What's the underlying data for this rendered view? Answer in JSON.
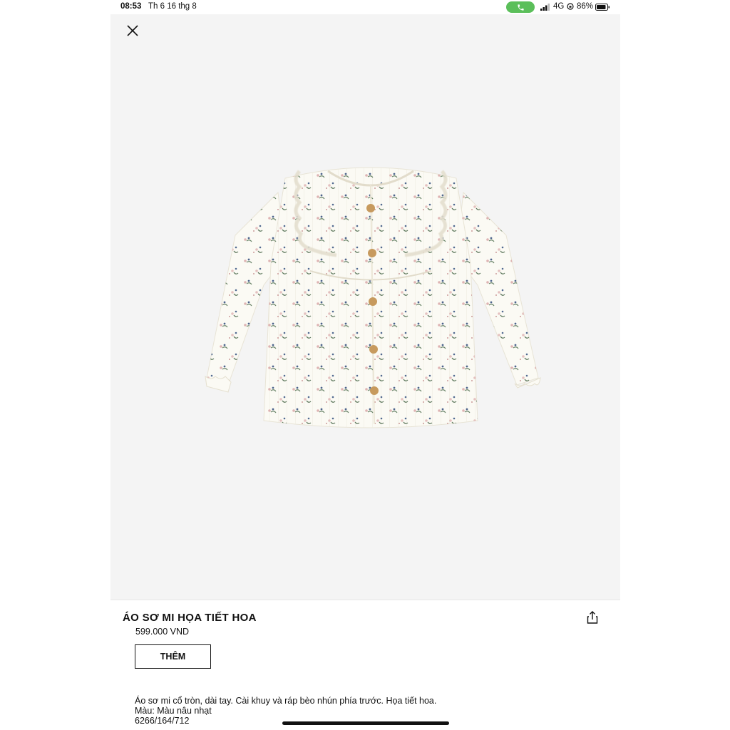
{
  "status_bar": {
    "time": "08:53",
    "date": "Th 6 16 thg 8",
    "network": "4G",
    "battery_percent": "86%",
    "battery_level": 0.86,
    "call_pill_color": "#5bbf5a"
  },
  "product": {
    "image_icon": "floral-blouse-photo",
    "title": "ÁO SƠ MI HỌA TIẾT HOA",
    "price": "599.000 VND",
    "add_button_label": "THÊM",
    "description": {
      "line1": "Áo sơ mi cổ tròn, dài tay. Cài khuy và ráp bèo nhún phía trước. Họa tiết hoa.",
      "line2": "Màu: Màu nâu nhạt",
      "line3": "6266/164/712"
    }
  },
  "icons": {
    "close": "close-icon",
    "share": "share-icon"
  },
  "colors": {
    "image_background": "#f4f4f4",
    "text": "#111111"
  }
}
